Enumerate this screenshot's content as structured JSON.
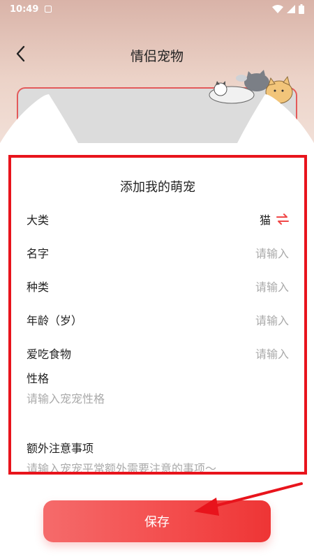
{
  "status_bar": {
    "time": "10:49"
  },
  "nav": {
    "title": "情侣宠物"
  },
  "form": {
    "title": "添加我的萌宠",
    "fields": [
      {
        "label": "大类",
        "value": "猫"
      },
      {
        "label": "名字",
        "placeholder": "请输入"
      },
      {
        "label": "种类",
        "placeholder": "请输入"
      },
      {
        "label": "年龄（岁）",
        "placeholder": "请输入"
      },
      {
        "label": "爱吃食物",
        "placeholder": "请输入"
      }
    ],
    "personality": {
      "label": "性格",
      "placeholder": "请输入宠宠性格"
    },
    "notes": {
      "label": "额外注意事项",
      "placeholder": "请输入宠宠平常额外需要注意的事项～"
    }
  },
  "save_label": "保存",
  "colors": {
    "accent": "#f34b4b",
    "highlight_box": "#e8141c"
  }
}
